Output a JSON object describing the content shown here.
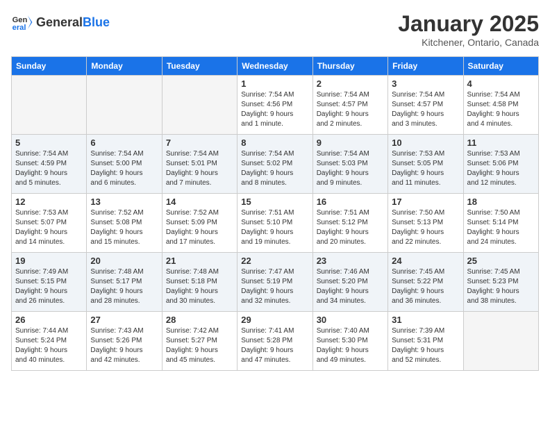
{
  "header": {
    "logo_general": "General",
    "logo_blue": "Blue",
    "month": "January 2025",
    "location": "Kitchener, Ontario, Canada"
  },
  "days_of_week": [
    "Sunday",
    "Monday",
    "Tuesday",
    "Wednesday",
    "Thursday",
    "Friday",
    "Saturday"
  ],
  "weeks": [
    [
      {
        "day": "",
        "info": ""
      },
      {
        "day": "",
        "info": ""
      },
      {
        "day": "",
        "info": ""
      },
      {
        "day": "1",
        "info": "Sunrise: 7:54 AM\nSunset: 4:56 PM\nDaylight: 9 hours\nand 1 minute."
      },
      {
        "day": "2",
        "info": "Sunrise: 7:54 AM\nSunset: 4:57 PM\nDaylight: 9 hours\nand 2 minutes."
      },
      {
        "day": "3",
        "info": "Sunrise: 7:54 AM\nSunset: 4:57 PM\nDaylight: 9 hours\nand 3 minutes."
      },
      {
        "day": "4",
        "info": "Sunrise: 7:54 AM\nSunset: 4:58 PM\nDaylight: 9 hours\nand 4 minutes."
      }
    ],
    [
      {
        "day": "5",
        "info": "Sunrise: 7:54 AM\nSunset: 4:59 PM\nDaylight: 9 hours\nand 5 minutes."
      },
      {
        "day": "6",
        "info": "Sunrise: 7:54 AM\nSunset: 5:00 PM\nDaylight: 9 hours\nand 6 minutes."
      },
      {
        "day": "7",
        "info": "Sunrise: 7:54 AM\nSunset: 5:01 PM\nDaylight: 9 hours\nand 7 minutes."
      },
      {
        "day": "8",
        "info": "Sunrise: 7:54 AM\nSunset: 5:02 PM\nDaylight: 9 hours\nand 8 minutes."
      },
      {
        "day": "9",
        "info": "Sunrise: 7:54 AM\nSunset: 5:03 PM\nDaylight: 9 hours\nand 9 minutes."
      },
      {
        "day": "10",
        "info": "Sunrise: 7:53 AM\nSunset: 5:05 PM\nDaylight: 9 hours\nand 11 minutes."
      },
      {
        "day": "11",
        "info": "Sunrise: 7:53 AM\nSunset: 5:06 PM\nDaylight: 9 hours\nand 12 minutes."
      }
    ],
    [
      {
        "day": "12",
        "info": "Sunrise: 7:53 AM\nSunset: 5:07 PM\nDaylight: 9 hours\nand 14 minutes."
      },
      {
        "day": "13",
        "info": "Sunrise: 7:52 AM\nSunset: 5:08 PM\nDaylight: 9 hours\nand 15 minutes."
      },
      {
        "day": "14",
        "info": "Sunrise: 7:52 AM\nSunset: 5:09 PM\nDaylight: 9 hours\nand 17 minutes."
      },
      {
        "day": "15",
        "info": "Sunrise: 7:51 AM\nSunset: 5:10 PM\nDaylight: 9 hours\nand 19 minutes."
      },
      {
        "day": "16",
        "info": "Sunrise: 7:51 AM\nSunset: 5:12 PM\nDaylight: 9 hours\nand 20 minutes."
      },
      {
        "day": "17",
        "info": "Sunrise: 7:50 AM\nSunset: 5:13 PM\nDaylight: 9 hours\nand 22 minutes."
      },
      {
        "day": "18",
        "info": "Sunrise: 7:50 AM\nSunset: 5:14 PM\nDaylight: 9 hours\nand 24 minutes."
      }
    ],
    [
      {
        "day": "19",
        "info": "Sunrise: 7:49 AM\nSunset: 5:15 PM\nDaylight: 9 hours\nand 26 minutes."
      },
      {
        "day": "20",
        "info": "Sunrise: 7:48 AM\nSunset: 5:17 PM\nDaylight: 9 hours\nand 28 minutes."
      },
      {
        "day": "21",
        "info": "Sunrise: 7:48 AM\nSunset: 5:18 PM\nDaylight: 9 hours\nand 30 minutes."
      },
      {
        "day": "22",
        "info": "Sunrise: 7:47 AM\nSunset: 5:19 PM\nDaylight: 9 hours\nand 32 minutes."
      },
      {
        "day": "23",
        "info": "Sunrise: 7:46 AM\nSunset: 5:20 PM\nDaylight: 9 hours\nand 34 minutes."
      },
      {
        "day": "24",
        "info": "Sunrise: 7:45 AM\nSunset: 5:22 PM\nDaylight: 9 hours\nand 36 minutes."
      },
      {
        "day": "25",
        "info": "Sunrise: 7:45 AM\nSunset: 5:23 PM\nDaylight: 9 hours\nand 38 minutes."
      }
    ],
    [
      {
        "day": "26",
        "info": "Sunrise: 7:44 AM\nSunset: 5:24 PM\nDaylight: 9 hours\nand 40 minutes."
      },
      {
        "day": "27",
        "info": "Sunrise: 7:43 AM\nSunset: 5:26 PM\nDaylight: 9 hours\nand 42 minutes."
      },
      {
        "day": "28",
        "info": "Sunrise: 7:42 AM\nSunset: 5:27 PM\nDaylight: 9 hours\nand 45 minutes."
      },
      {
        "day": "29",
        "info": "Sunrise: 7:41 AM\nSunset: 5:28 PM\nDaylight: 9 hours\nand 47 minutes."
      },
      {
        "day": "30",
        "info": "Sunrise: 7:40 AM\nSunset: 5:30 PM\nDaylight: 9 hours\nand 49 minutes."
      },
      {
        "day": "31",
        "info": "Sunrise: 7:39 AM\nSunset: 5:31 PM\nDaylight: 9 hours\nand 52 minutes."
      },
      {
        "day": "",
        "info": ""
      }
    ]
  ]
}
